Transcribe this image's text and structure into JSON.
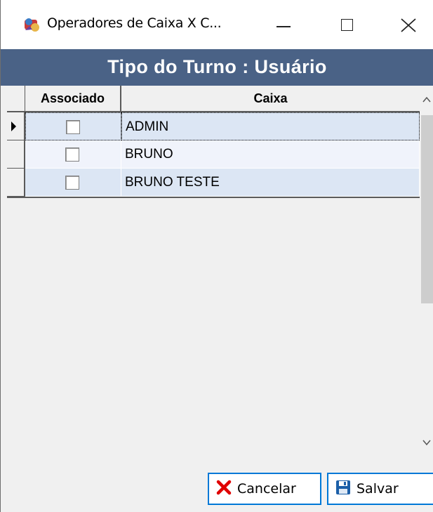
{
  "window": {
    "title": "Operadores de Caixa X C...",
    "app_icon": "app-icon",
    "controls": [
      "minimize-icon",
      "maximize-icon",
      "close-icon"
    ]
  },
  "header": {
    "title": "Tipo do Turno : Usuário"
  },
  "grid": {
    "columns": [
      {
        "label": "Associado"
      },
      {
        "label": "Caixa"
      }
    ],
    "rows": [
      {
        "associado": false,
        "caixa": "ADMIN",
        "current": true
      },
      {
        "associado": false,
        "caixa": "BRUNO",
        "current": false
      },
      {
        "associado": false,
        "caixa": "BRUNO TESTE",
        "current": false
      }
    ]
  },
  "buttons": {
    "cancel_label": "Cancelar",
    "save_label": "Salvar"
  },
  "colors": {
    "header_bg": "#4a6286",
    "row_odd": "#dce6f4",
    "row_even": "#f0f3fb",
    "button_border": "#0078d7",
    "cancel_icon": "#e00000",
    "save_icon": "#1c5fa8"
  }
}
